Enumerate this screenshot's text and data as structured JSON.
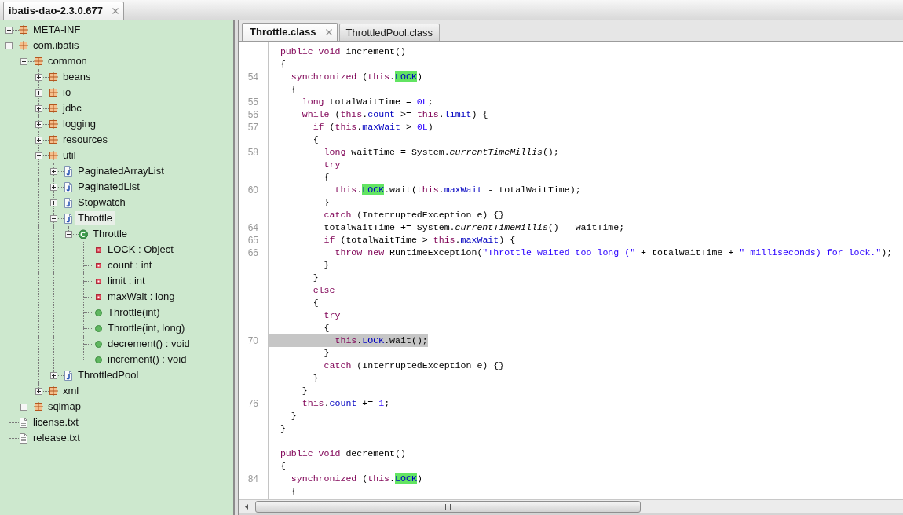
{
  "top_tabs": [
    {
      "label": "ibatis-dao-2.3.0.677",
      "selected": true
    }
  ],
  "tree": [
    {
      "kind": "package",
      "label": "META-INF",
      "expanded": false,
      "selected": false
    },
    {
      "kind": "package",
      "label": "com.ibatis",
      "expanded": true,
      "selected": false,
      "children": [
        {
          "kind": "package",
          "label": "common",
          "expanded": true,
          "selected": false,
          "children": [
            {
              "kind": "package",
              "label": "beans",
              "expanded": false,
              "selected": false
            },
            {
              "kind": "package",
              "label": "io",
              "expanded": false,
              "selected": false
            },
            {
              "kind": "package",
              "label": "jdbc",
              "expanded": false,
              "selected": false
            },
            {
              "kind": "package",
              "label": "logging",
              "expanded": false,
              "selected": false
            },
            {
              "kind": "package",
              "label": "resources",
              "expanded": false,
              "selected": false
            },
            {
              "kind": "package",
              "label": "util",
              "expanded": true,
              "selected": false,
              "children": [
                {
                  "kind": "source_file",
                  "label": "PaginatedArrayList",
                  "expanded": false,
                  "selected": false
                },
                {
                  "kind": "source_file",
                  "label": "PaginatedList",
                  "expanded": false,
                  "selected": false
                },
                {
                  "kind": "source_file",
                  "label": "Stopwatch",
                  "expanded": false,
                  "selected": false
                },
                {
                  "kind": "source_file",
                  "label": "Throttle",
                  "expanded": true,
                  "selected": true,
                  "children": [
                    {
                      "kind": "class",
                      "label": "Throttle",
                      "expanded": true,
                      "selected": false,
                      "children": [
                        {
                          "kind": "field",
                          "label": "LOCK : Object",
                          "selected": false
                        },
                        {
                          "kind": "field",
                          "label": "count : int",
                          "selected": false
                        },
                        {
                          "kind": "field",
                          "label": "limit : int",
                          "selected": false
                        },
                        {
                          "kind": "field",
                          "label": "maxWait : long",
                          "selected": false
                        },
                        {
                          "kind": "method",
                          "label": "Throttle(int)",
                          "selected": false
                        },
                        {
                          "kind": "method",
                          "label": "Throttle(int, long)",
                          "selected": false
                        },
                        {
                          "kind": "method",
                          "label": "decrement() : void",
                          "selected": false
                        },
                        {
                          "kind": "method",
                          "label": "increment() : void",
                          "selected": false
                        }
                      ]
                    }
                  ]
                },
                {
                  "kind": "source_file",
                  "label": "ThrottledPool",
                  "expanded": false,
                  "selected": false
                }
              ]
            },
            {
              "kind": "package",
              "label": "xml",
              "expanded": false,
              "selected": false
            }
          ]
        },
        {
          "kind": "package",
          "label": "sqlmap",
          "expanded": false,
          "selected": false
        }
      ]
    },
    {
      "kind": "text_file",
      "label": "license.txt",
      "selected": false
    },
    {
      "kind": "text_file",
      "label": "release.txt",
      "selected": false
    }
  ],
  "editor": {
    "tabs": [
      {
        "label": "Throttle.class",
        "selected": true
      },
      {
        "label": "ThrottledPool.class",
        "selected": false
      }
    ],
    "lines": [
      {
        "highlighted": false,
        "code": [
          {
            "kind": "keyword",
            "text": "  public void"
          },
          {
            "kind": "plain",
            "text": " increment()"
          }
        ]
      },
      {
        "highlighted": false,
        "code": [
          {
            "kind": "plain",
            "text": "  {"
          }
        ]
      },
      {
        "number": "54",
        "highlighted": false,
        "code": [
          {
            "kind": "keyword",
            "text": "    synchronized"
          },
          {
            "kind": "plain",
            "text": " ("
          },
          {
            "kind": "keyword",
            "text": "this"
          },
          {
            "kind": "plain",
            "text": "."
          },
          {
            "kind": "occurrence",
            "text": "LOCK"
          },
          {
            "kind": "plain",
            "text": ")"
          }
        ]
      },
      {
        "highlighted": false,
        "code": [
          {
            "kind": "plain",
            "text": "    {"
          }
        ]
      },
      {
        "number": "55",
        "highlighted": false,
        "code": [
          {
            "kind": "keyword",
            "text": "      long"
          },
          {
            "kind": "plain",
            "text": " totalWaitTime = "
          },
          {
            "kind": "number",
            "text": "0L"
          },
          {
            "kind": "plain",
            "text": ";"
          }
        ]
      },
      {
        "number": "56",
        "highlighted": false,
        "code": [
          {
            "kind": "keyword",
            "text": "      while"
          },
          {
            "kind": "plain",
            "text": " ("
          },
          {
            "kind": "keyword",
            "text": "this"
          },
          {
            "kind": "plain",
            "text": "."
          },
          {
            "kind": "field",
            "text": "count"
          },
          {
            "kind": "plain",
            "text": " >= "
          },
          {
            "kind": "keyword",
            "text": "this"
          },
          {
            "kind": "plain",
            "text": "."
          },
          {
            "kind": "field",
            "text": "limit"
          },
          {
            "kind": "plain",
            "text": ") {"
          }
        ]
      },
      {
        "number": "57",
        "highlighted": false,
        "code": [
          {
            "kind": "keyword",
            "text": "        if"
          },
          {
            "kind": "plain",
            "text": " ("
          },
          {
            "kind": "keyword",
            "text": "this"
          },
          {
            "kind": "plain",
            "text": "."
          },
          {
            "kind": "field",
            "text": "maxWait"
          },
          {
            "kind": "plain",
            "text": " > "
          },
          {
            "kind": "number",
            "text": "0L"
          },
          {
            "kind": "plain",
            "text": ")"
          }
        ]
      },
      {
        "highlighted": false,
        "code": [
          {
            "kind": "plain",
            "text": "        {"
          }
        ]
      },
      {
        "number": "58",
        "highlighted": false,
        "code": [
          {
            "kind": "keyword",
            "text": "          long"
          },
          {
            "kind": "plain",
            "text": " waitTime = System."
          },
          {
            "kind": "static_call",
            "text": "currentTimeMillis"
          },
          {
            "kind": "plain",
            "text": "();"
          }
        ]
      },
      {
        "highlighted": false,
        "code": [
          {
            "kind": "keyword",
            "text": "          try"
          }
        ]
      },
      {
        "highlighted": false,
        "code": [
          {
            "kind": "plain",
            "text": "          {"
          }
        ]
      },
      {
        "number": "60",
        "highlighted": false,
        "code": [
          {
            "kind": "keyword",
            "text": "            this"
          },
          {
            "kind": "plain",
            "text": "."
          },
          {
            "kind": "occurrence",
            "text": "LOCK"
          },
          {
            "kind": "plain",
            "text": ".wait("
          },
          {
            "kind": "keyword",
            "text": "this"
          },
          {
            "kind": "plain",
            "text": "."
          },
          {
            "kind": "field",
            "text": "maxWait"
          },
          {
            "kind": "plain",
            "text": " - totalWaitTime);"
          }
        ]
      },
      {
        "highlighted": false,
        "code": [
          {
            "kind": "plain",
            "text": "          }"
          }
        ]
      },
      {
        "highlighted": false,
        "code": [
          {
            "kind": "keyword",
            "text": "          catch"
          },
          {
            "kind": "plain",
            "text": " (InterruptedException e) {}"
          }
        ]
      },
      {
        "number": "64",
        "highlighted": false,
        "code": [
          {
            "kind": "plain",
            "text": "          totalWaitTime += System."
          },
          {
            "kind": "static_call",
            "text": "currentTimeMillis"
          },
          {
            "kind": "plain",
            "text": "() - waitTime;"
          }
        ]
      },
      {
        "number": "65",
        "highlighted": false,
        "code": [
          {
            "kind": "keyword",
            "text": "          if"
          },
          {
            "kind": "plain",
            "text": " (totalWaitTime > "
          },
          {
            "kind": "keyword",
            "text": "this"
          },
          {
            "kind": "plain",
            "text": "."
          },
          {
            "kind": "field",
            "text": "maxWait"
          },
          {
            "kind": "plain",
            "text": ") {"
          }
        ]
      },
      {
        "number": "66",
        "highlighted": false,
        "code": [
          {
            "kind": "keyword",
            "text": "            throw new"
          },
          {
            "kind": "plain",
            "text": " RuntimeException("
          },
          {
            "kind": "string",
            "text": "\"Throttle waited too long (\""
          },
          {
            "kind": "plain",
            "text": " + totalWaitTime + "
          },
          {
            "kind": "string",
            "text": "\" milliseconds) for lock.\""
          },
          {
            "kind": "plain",
            "text": ");"
          }
        ]
      },
      {
        "highlighted": false,
        "code": [
          {
            "kind": "plain",
            "text": "          }"
          }
        ]
      },
      {
        "highlighted": false,
        "code": [
          {
            "kind": "plain",
            "text": "        }"
          }
        ]
      },
      {
        "highlighted": false,
        "code": [
          {
            "kind": "keyword",
            "text": "        else"
          }
        ]
      },
      {
        "highlighted": false,
        "code": [
          {
            "kind": "plain",
            "text": "        {"
          }
        ]
      },
      {
        "highlighted": false,
        "code": [
          {
            "kind": "keyword",
            "text": "          try"
          }
        ]
      },
      {
        "highlighted": false,
        "code": [
          {
            "kind": "plain",
            "text": "          {"
          }
        ]
      },
      {
        "number": "70",
        "highlighted": true,
        "code": [
          {
            "kind": "keyword",
            "text": "            this"
          },
          {
            "kind": "plain",
            "text": "."
          },
          {
            "kind": "field",
            "text": "LOCK"
          },
          {
            "kind": "plain",
            "text": ".wait();"
          }
        ]
      },
      {
        "highlighted": false,
        "code": [
          {
            "kind": "plain",
            "text": "          }"
          }
        ]
      },
      {
        "highlighted": false,
        "code": [
          {
            "kind": "keyword",
            "text": "          catch"
          },
          {
            "kind": "plain",
            "text": " (InterruptedException e) {}"
          }
        ]
      },
      {
        "highlighted": false,
        "code": [
          {
            "kind": "plain",
            "text": "        }"
          }
        ]
      },
      {
        "highlighted": false,
        "code": [
          {
            "kind": "plain",
            "text": "      }"
          }
        ]
      },
      {
        "number": "76",
        "highlighted": false,
        "code": [
          {
            "kind": "keyword",
            "text": "      this"
          },
          {
            "kind": "plain",
            "text": "."
          },
          {
            "kind": "field",
            "text": "count"
          },
          {
            "kind": "plain",
            "text": " += "
          },
          {
            "kind": "number",
            "text": "1"
          },
          {
            "kind": "plain",
            "text": ";"
          }
        ]
      },
      {
        "highlighted": false,
        "code": [
          {
            "kind": "plain",
            "text": "    }"
          }
        ]
      },
      {
        "highlighted": false,
        "code": [
          {
            "kind": "plain",
            "text": "  }"
          }
        ]
      },
      {
        "highlighted": false
      },
      {
        "highlighted": false,
        "code": [
          {
            "kind": "keyword",
            "text": "  public void"
          },
          {
            "kind": "plain",
            "text": " decrement()"
          }
        ]
      },
      {
        "highlighted": false,
        "code": [
          {
            "kind": "plain",
            "text": "  {"
          }
        ]
      },
      {
        "number": "84",
        "highlighted": false,
        "code": [
          {
            "kind": "keyword",
            "text": "    synchronized"
          },
          {
            "kind": "plain",
            "text": " ("
          },
          {
            "kind": "keyword",
            "text": "this"
          },
          {
            "kind": "plain",
            "text": "."
          },
          {
            "kind": "occurrence",
            "text": "LOCK"
          },
          {
            "kind": "plain",
            "text": ")"
          }
        ]
      },
      {
        "highlighted": false,
        "code": [
          {
            "kind": "plain",
            "text": "    {"
          }
        ]
      }
    ]
  }
}
